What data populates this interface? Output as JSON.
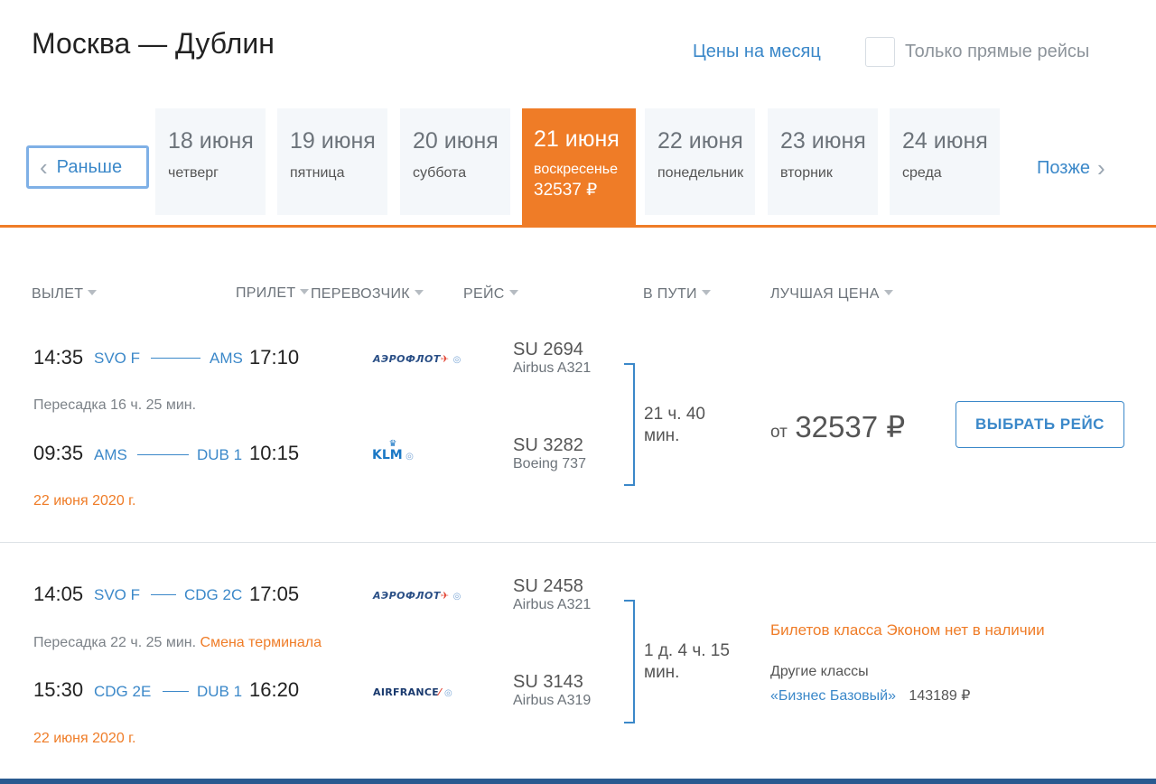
{
  "header": {
    "title": "Москва — Дублин",
    "month_prices_link": "Цены на месяц",
    "direct_only_label": "Только прямые рейсы"
  },
  "nav": {
    "earlier": "Раньше",
    "later": "Позже"
  },
  "days": [
    {
      "date": "18 июня",
      "weekday": "четверг",
      "price": ""
    },
    {
      "date": "19 июня",
      "weekday": "пятница",
      "price": ""
    },
    {
      "date": "20 июня",
      "weekday": "суббота",
      "price": ""
    },
    {
      "date": "21 июня",
      "weekday": "воскресенье",
      "price": "32537 ₽",
      "selected": true
    },
    {
      "date": "22 июня",
      "weekday": "понедельник",
      "price": ""
    },
    {
      "date": "23 июня",
      "weekday": "вторник",
      "price": ""
    },
    {
      "date": "24 июня",
      "weekday": "среда",
      "price": ""
    }
  ],
  "columns": {
    "departure": "ВЫЛЕТ",
    "arrival": "ПРИЛЕТ",
    "carrier": "ПЕРЕВОЗЧИК",
    "flight": "РЕЙС",
    "duration": "В ПУТИ",
    "best_price": "ЛУЧШАЯ ЦЕНА"
  },
  "results": [
    {
      "legs": [
        {
          "dep_time": "14:35",
          "dep_airport": "SVO F",
          "arr_airport": "AMS",
          "arr_time": "17:10",
          "carrier_logo": "АЭРОФЛОТ",
          "flight_no": "SU 2694",
          "aircraft": "Airbus A321"
        },
        {
          "dep_time": "09:35",
          "dep_airport": "AMS",
          "arr_airport": "DUB 1",
          "arr_time": "10:15",
          "carrier_logo": "KLM",
          "flight_no": "SU 3282",
          "aircraft": "Boeing 737"
        }
      ],
      "transfer": "Пересадка 16 ч. 25 мин.",
      "transfer_note": "",
      "arrival_date": "22 июня 2020 г.",
      "duration_line1": "21 ч. 40",
      "duration_line2": "мин.",
      "price_prefix": "от",
      "price": "32537 ₽",
      "select_label": "ВЫБРАТЬ РЕЙС"
    },
    {
      "legs": [
        {
          "dep_time": "14:05",
          "dep_airport": "SVO F",
          "arr_airport": "CDG 2C",
          "arr_time": "17:05",
          "carrier_logo": "АЭРОФЛОТ",
          "flight_no": "SU 2458",
          "aircraft": "Airbus A321"
        },
        {
          "dep_time": "15:30",
          "dep_airport": "CDG 2E",
          "arr_airport": "DUB 1",
          "arr_time": "16:20",
          "carrier_logo": "AIRFRANCE",
          "flight_no": "SU 3143",
          "aircraft": "Airbus A319"
        }
      ],
      "transfer": "Пересадка 22 ч. 25 мин.",
      "transfer_note": "Смена терминала",
      "arrival_date": "22 июня 2020 г.",
      "duration_line1": "1 д. 4 ч. 15",
      "duration_line2": "мин.",
      "unavailable": "Билетов класса Эконом нет в наличии",
      "other_classes_label": "Другие классы",
      "other_class_name": "«Бизнес Базовый»",
      "other_class_price": "143189 ₽"
    }
  ],
  "colors": {
    "accent": "#ef7c27",
    "link": "#3b88c9"
  }
}
